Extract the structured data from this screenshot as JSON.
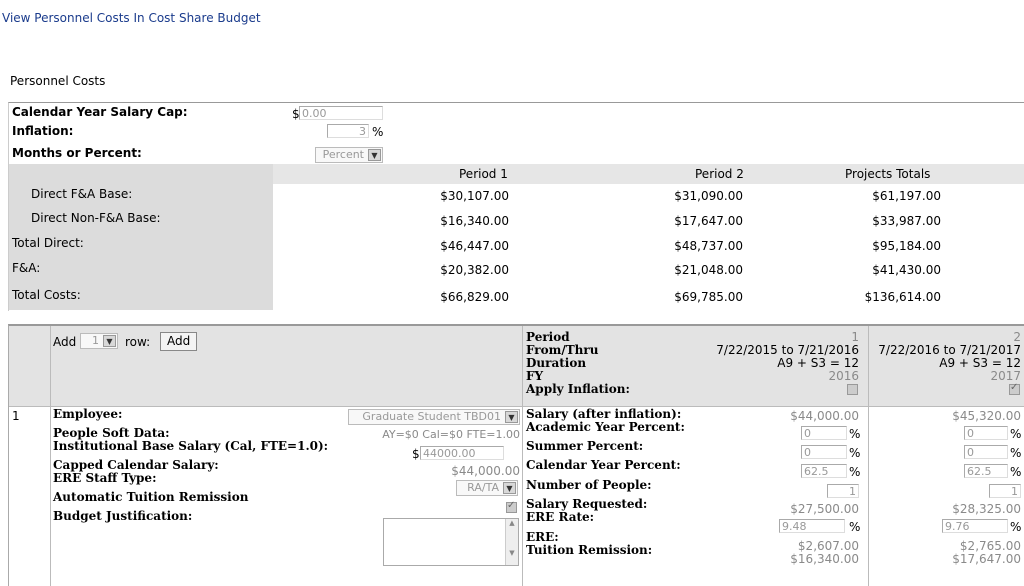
{
  "header": {
    "link": "View Personnel Costs In Cost Share Budget"
  },
  "section_title": "Personnel Costs",
  "settings": {
    "salary_cap_label": "Calendar Year Salary Cap:",
    "salary_cap_prefix": "$",
    "salary_cap_value": "0.00",
    "inflation_label": "Inflation:",
    "inflation_value": "3",
    "inflation_unit": "%",
    "months_label": "Months or Percent:",
    "months_value": "Percent"
  },
  "summary": {
    "headers": [
      "Period 1",
      "Period 2",
      "Projects Totals"
    ],
    "rows": [
      {
        "label": "Direct F&A Base:",
        "values": [
          "$30,107.00",
          "$31,090.00",
          "$61,197.00"
        ]
      },
      {
        "label": "Direct Non-F&A Base:",
        "values": [
          "$16,340.00",
          "$17,647.00",
          "$33,987.00"
        ]
      },
      {
        "label": "Total Direct:",
        "values": [
          "$46,447.00",
          "$48,737.00",
          "$95,184.00"
        ]
      },
      {
        "label": "F&A:",
        "values": [
          "$20,382.00",
          "$21,048.00",
          "$41,430.00"
        ]
      },
      {
        "label": "Total Costs:",
        "values": [
          "$66,829.00",
          "$69,785.00",
          "$136,614.00"
        ]
      }
    ]
  },
  "detail": {
    "add_label": "Add",
    "add_count": "1",
    "row_label": "row:",
    "add_button": "Add",
    "period_labels": [
      "Period",
      "From/Thru",
      "Duration",
      "FY",
      "Apply Inflation:"
    ],
    "periods": [
      {
        "number": "1",
        "from_thru": "7/22/2015 to 7/21/2016",
        "duration": "A9 + S3 = 12",
        "fy": "2016",
        "salary": "$44,000.00",
        "academic_pct": "0",
        "summer_pct": "0",
        "calendar_pct": "62.5",
        "people": "1",
        "salary_requested": "$27,500.00",
        "ere_rate": "9.48",
        "ere": "$2,607.00",
        "tuition": "$16,340.00"
      },
      {
        "number": "2",
        "from_thru": "7/22/2016 to 7/21/2017",
        "duration": "A9 + S3 = 12",
        "fy": "2017",
        "salary": "$45,320.00",
        "academic_pct": "0",
        "summer_pct": "0",
        "calendar_pct": "62.5",
        "people": "1",
        "salary_requested": "$28,325.00",
        "ere_rate": "9.76",
        "ere": "$2,765.00",
        "tuition": "$17,647.00"
      }
    ],
    "pct_unit": "%",
    "row": {
      "index": "1",
      "employee_label": "Employee:",
      "employee_value": "Graduate Student TBD01",
      "peoplesoft_label": "People Soft Data:",
      "peoplesoft_value": "AY=$0 Cal=$0 FTE=1.00",
      "base_salary_label": "Institutional Base Salary (Cal, FTE=1.0):",
      "base_salary_prefix": "$",
      "base_salary_value": "44000.00",
      "capped_label": "Capped Calendar Salary:",
      "capped_value": "$44,000.00",
      "ere_staff_label": "ERE Staff Type:",
      "ere_staff_value": "RA/TA",
      "tuition_auto_label": "Automatic Tuition Remission",
      "justification_label": "Budget Justification:"
    },
    "metric_labels": {
      "salary": "Salary (after inflation):",
      "academic": "Academic Year Percent:",
      "summer": "Summer Percent:",
      "calendar": "Calendar Year Percent:",
      "people": "Number of People:",
      "salary_requested": "Salary Requested:",
      "ere_rate": "ERE Rate:",
      "ere": "ERE:",
      "tuition": "Tuition Remission:"
    }
  }
}
